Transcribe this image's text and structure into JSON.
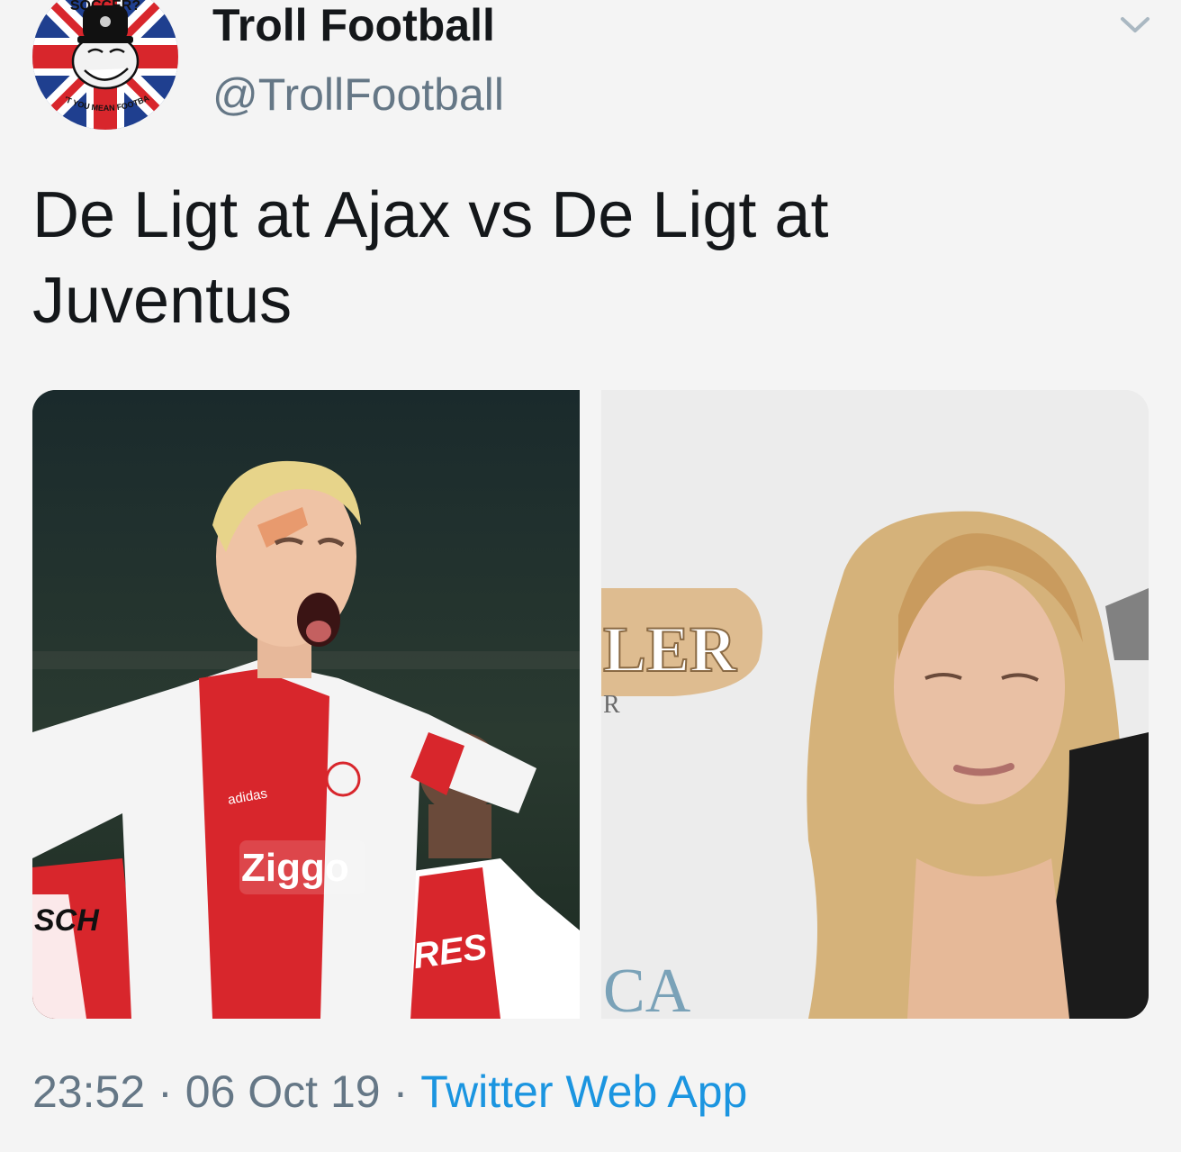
{
  "account": {
    "display_name": "Troll Football",
    "handle": "@TrollFootball",
    "avatar": {
      "icon": "troll-face-union-jack-avatar",
      "top_text": "SOCCER?",
      "bottom_text": "DON'T YOU MEAN FOOTBALL?"
    }
  },
  "menu": {
    "icon": "chevron-down-icon"
  },
  "tweet": {
    "text": "De Ligt at Ajax vs De Ligt at Juventus"
  },
  "media": {
    "left": {
      "description": "football-player-in-ajax-kit",
      "visible_text": [
        "adidas",
        "Ziggo",
        "NERES",
        "SCH"
      ]
    },
    "right": {
      "description": "blonde-woman-at-press-backdrop",
      "visible_text": [
        "LER",
        "R",
        "CA"
      ]
    }
  },
  "meta": {
    "time": "23:52",
    "separator": "·",
    "date": "06 Oct 19",
    "source": "Twitter Web App"
  },
  "colors": {
    "background": "#f4f4f4",
    "text": "#14171a",
    "secondary": "#657786",
    "link": "#1b95e0"
  }
}
